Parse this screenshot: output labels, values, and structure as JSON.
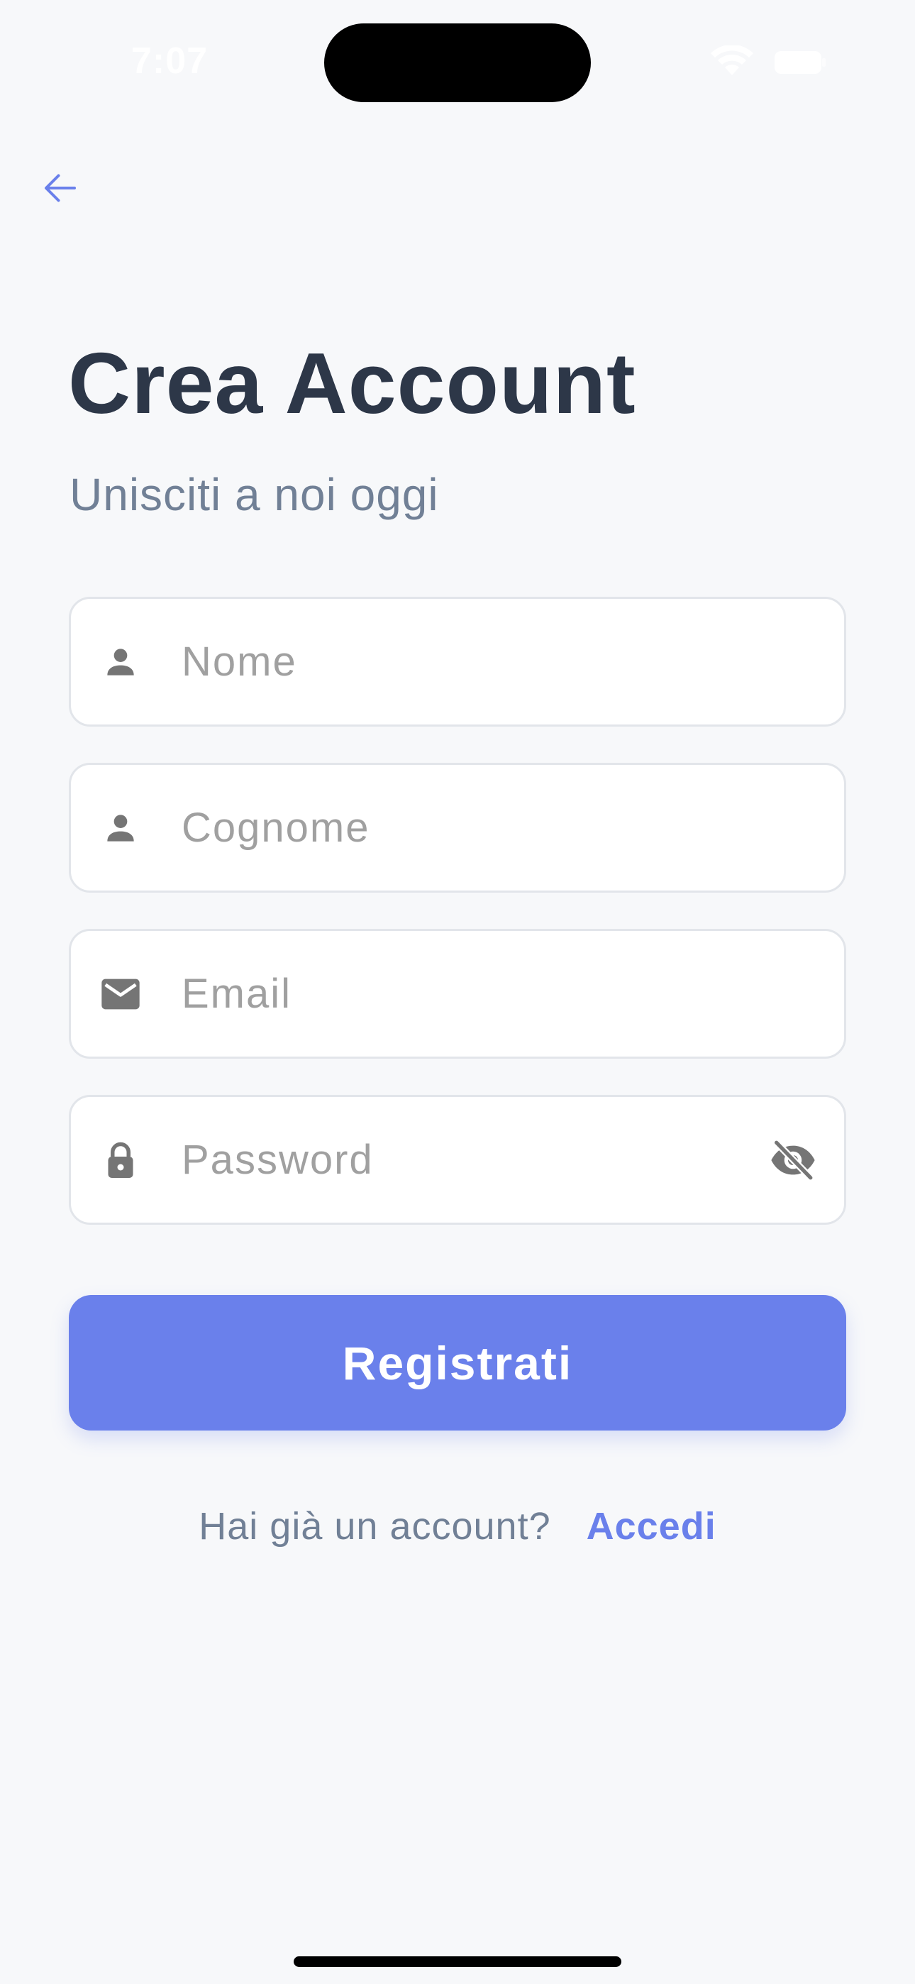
{
  "status_bar": {
    "time": "7:07"
  },
  "header": {
    "back_icon": "arrow-left-icon"
  },
  "page": {
    "title": "Crea Account",
    "subtitle": "Unisciti a noi oggi"
  },
  "form": {
    "first_name": {
      "placeholder": "Nome",
      "value": "",
      "icon": "person-icon"
    },
    "last_name": {
      "placeholder": "Cognome",
      "value": "",
      "icon": "person-icon"
    },
    "email": {
      "placeholder": "Email",
      "value": "",
      "icon": "mail-icon"
    },
    "password": {
      "placeholder": "Password",
      "value": "",
      "icon": "lock-icon",
      "visibility_icon": "eye-off-icon"
    },
    "submit_label": "Registrati"
  },
  "footer": {
    "prompt": "Hai già un account?",
    "login_label": "Accedi"
  },
  "colors": {
    "accent": "#6a80eb",
    "background": "#f7f8fa",
    "title": "#2d3748",
    "muted": "#718096",
    "icon": "#757575",
    "placeholder": "#a0a0a0"
  }
}
